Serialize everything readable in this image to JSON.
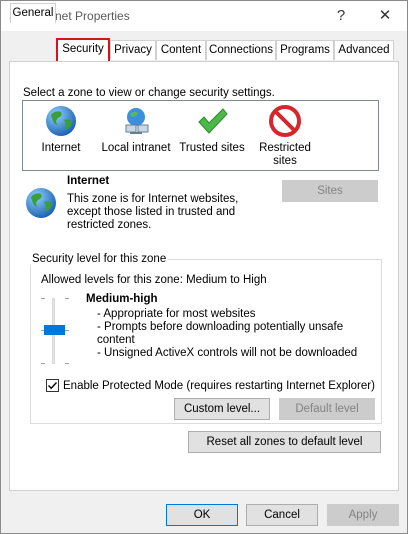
{
  "window": {
    "title": "Internet Properties",
    "help_glyph": "?",
    "close_glyph": "✕"
  },
  "tabs": [
    {
      "label": "General"
    },
    {
      "label": "Security"
    },
    {
      "label": "Privacy"
    },
    {
      "label": "Content"
    },
    {
      "label": "Connections"
    },
    {
      "label": "Programs"
    },
    {
      "label": "Advanced"
    }
  ],
  "active_tab": "Security",
  "zones": {
    "instruction": "Select a zone to view or change security settings.",
    "items": [
      {
        "label": "Internet",
        "icon": "globe-icon"
      },
      {
        "label": "Local intranet",
        "icon": "intranet-icon"
      },
      {
        "label": "Trusted sites",
        "icon": "checkmark-icon"
      },
      {
        "label": "Restricted sites",
        "icon": "no-entry-icon"
      }
    ],
    "selected": "Internet"
  },
  "zone_info": {
    "title": "Internet",
    "description": "This zone is for Internet websites, except those listed in trusted and restricted zones.",
    "sites_button": "Sites"
  },
  "security_level": {
    "group_label": "Security level for this zone",
    "allowed": "Allowed levels for this zone: Medium to High",
    "level": "Medium-high",
    "bullets": [
      "- Appropriate for most websites",
      "- Prompts before downloading potentially unsafe content",
      "- Unsigned ActiveX controls will not be downloaded"
    ],
    "slider_level_fraction": 0.33
  },
  "protected_mode": {
    "label": "Enable Protected Mode (requires restarting Internet Explorer)",
    "checked": true
  },
  "buttons": {
    "custom_level": "Custom level...",
    "default_level": "Default level",
    "reset_all": "Reset all zones to default level",
    "ok": "OK",
    "cancel": "Cancel",
    "apply": "Apply"
  },
  "colors": {
    "tab_highlight": "#d3141b",
    "accent": "#0078d7"
  }
}
